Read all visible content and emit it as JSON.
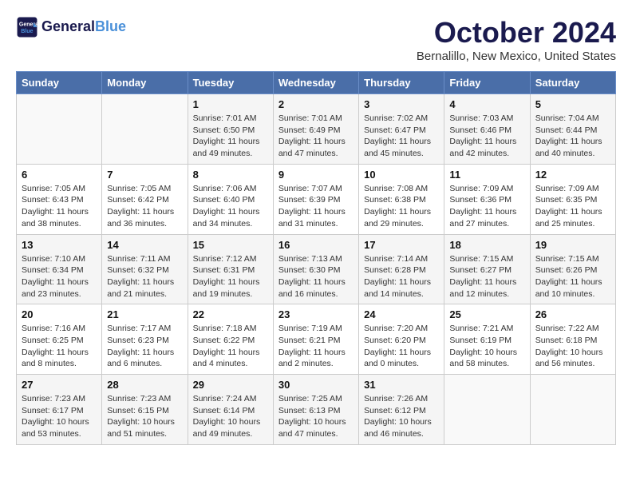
{
  "header": {
    "logo_line1": "General",
    "logo_line2": "Blue",
    "month": "October 2024",
    "location": "Bernalillo, New Mexico, United States"
  },
  "days_of_week": [
    "Sunday",
    "Monday",
    "Tuesday",
    "Wednesday",
    "Thursday",
    "Friday",
    "Saturday"
  ],
  "weeks": [
    [
      {
        "day": "",
        "sunrise": "",
        "sunset": "",
        "daylight": ""
      },
      {
        "day": "",
        "sunrise": "",
        "sunset": "",
        "daylight": ""
      },
      {
        "day": "1",
        "sunrise": "Sunrise: 7:01 AM",
        "sunset": "Sunset: 6:50 PM",
        "daylight": "Daylight: 11 hours and 49 minutes."
      },
      {
        "day": "2",
        "sunrise": "Sunrise: 7:01 AM",
        "sunset": "Sunset: 6:49 PM",
        "daylight": "Daylight: 11 hours and 47 minutes."
      },
      {
        "day": "3",
        "sunrise": "Sunrise: 7:02 AM",
        "sunset": "Sunset: 6:47 PM",
        "daylight": "Daylight: 11 hours and 45 minutes."
      },
      {
        "day": "4",
        "sunrise": "Sunrise: 7:03 AM",
        "sunset": "Sunset: 6:46 PM",
        "daylight": "Daylight: 11 hours and 42 minutes."
      },
      {
        "day": "5",
        "sunrise": "Sunrise: 7:04 AM",
        "sunset": "Sunset: 6:44 PM",
        "daylight": "Daylight: 11 hours and 40 minutes."
      }
    ],
    [
      {
        "day": "6",
        "sunrise": "Sunrise: 7:05 AM",
        "sunset": "Sunset: 6:43 PM",
        "daylight": "Daylight: 11 hours and 38 minutes."
      },
      {
        "day": "7",
        "sunrise": "Sunrise: 7:05 AM",
        "sunset": "Sunset: 6:42 PM",
        "daylight": "Daylight: 11 hours and 36 minutes."
      },
      {
        "day": "8",
        "sunrise": "Sunrise: 7:06 AM",
        "sunset": "Sunset: 6:40 PM",
        "daylight": "Daylight: 11 hours and 34 minutes."
      },
      {
        "day": "9",
        "sunrise": "Sunrise: 7:07 AM",
        "sunset": "Sunset: 6:39 PM",
        "daylight": "Daylight: 11 hours and 31 minutes."
      },
      {
        "day": "10",
        "sunrise": "Sunrise: 7:08 AM",
        "sunset": "Sunset: 6:38 PM",
        "daylight": "Daylight: 11 hours and 29 minutes."
      },
      {
        "day": "11",
        "sunrise": "Sunrise: 7:09 AM",
        "sunset": "Sunset: 6:36 PM",
        "daylight": "Daylight: 11 hours and 27 minutes."
      },
      {
        "day": "12",
        "sunrise": "Sunrise: 7:09 AM",
        "sunset": "Sunset: 6:35 PM",
        "daylight": "Daylight: 11 hours and 25 minutes."
      }
    ],
    [
      {
        "day": "13",
        "sunrise": "Sunrise: 7:10 AM",
        "sunset": "Sunset: 6:34 PM",
        "daylight": "Daylight: 11 hours and 23 minutes."
      },
      {
        "day": "14",
        "sunrise": "Sunrise: 7:11 AM",
        "sunset": "Sunset: 6:32 PM",
        "daylight": "Daylight: 11 hours and 21 minutes."
      },
      {
        "day": "15",
        "sunrise": "Sunrise: 7:12 AM",
        "sunset": "Sunset: 6:31 PM",
        "daylight": "Daylight: 11 hours and 19 minutes."
      },
      {
        "day": "16",
        "sunrise": "Sunrise: 7:13 AM",
        "sunset": "Sunset: 6:30 PM",
        "daylight": "Daylight: 11 hours and 16 minutes."
      },
      {
        "day": "17",
        "sunrise": "Sunrise: 7:14 AM",
        "sunset": "Sunset: 6:28 PM",
        "daylight": "Daylight: 11 hours and 14 minutes."
      },
      {
        "day": "18",
        "sunrise": "Sunrise: 7:15 AM",
        "sunset": "Sunset: 6:27 PM",
        "daylight": "Daylight: 11 hours and 12 minutes."
      },
      {
        "day": "19",
        "sunrise": "Sunrise: 7:15 AM",
        "sunset": "Sunset: 6:26 PM",
        "daylight": "Daylight: 11 hours and 10 minutes."
      }
    ],
    [
      {
        "day": "20",
        "sunrise": "Sunrise: 7:16 AM",
        "sunset": "Sunset: 6:25 PM",
        "daylight": "Daylight: 11 hours and 8 minutes."
      },
      {
        "day": "21",
        "sunrise": "Sunrise: 7:17 AM",
        "sunset": "Sunset: 6:23 PM",
        "daylight": "Daylight: 11 hours and 6 minutes."
      },
      {
        "day": "22",
        "sunrise": "Sunrise: 7:18 AM",
        "sunset": "Sunset: 6:22 PM",
        "daylight": "Daylight: 11 hours and 4 minutes."
      },
      {
        "day": "23",
        "sunrise": "Sunrise: 7:19 AM",
        "sunset": "Sunset: 6:21 PM",
        "daylight": "Daylight: 11 hours and 2 minutes."
      },
      {
        "day": "24",
        "sunrise": "Sunrise: 7:20 AM",
        "sunset": "Sunset: 6:20 PM",
        "daylight": "Daylight: 11 hours and 0 minutes."
      },
      {
        "day": "25",
        "sunrise": "Sunrise: 7:21 AM",
        "sunset": "Sunset: 6:19 PM",
        "daylight": "Daylight: 10 hours and 58 minutes."
      },
      {
        "day": "26",
        "sunrise": "Sunrise: 7:22 AM",
        "sunset": "Sunset: 6:18 PM",
        "daylight": "Daylight: 10 hours and 56 minutes."
      }
    ],
    [
      {
        "day": "27",
        "sunrise": "Sunrise: 7:23 AM",
        "sunset": "Sunset: 6:17 PM",
        "daylight": "Daylight: 10 hours and 53 minutes."
      },
      {
        "day": "28",
        "sunrise": "Sunrise: 7:23 AM",
        "sunset": "Sunset: 6:15 PM",
        "daylight": "Daylight: 10 hours and 51 minutes."
      },
      {
        "day": "29",
        "sunrise": "Sunrise: 7:24 AM",
        "sunset": "Sunset: 6:14 PM",
        "daylight": "Daylight: 10 hours and 49 minutes."
      },
      {
        "day": "30",
        "sunrise": "Sunrise: 7:25 AM",
        "sunset": "Sunset: 6:13 PM",
        "daylight": "Daylight: 10 hours and 47 minutes."
      },
      {
        "day": "31",
        "sunrise": "Sunrise: 7:26 AM",
        "sunset": "Sunset: 6:12 PM",
        "daylight": "Daylight: 10 hours and 46 minutes."
      },
      {
        "day": "",
        "sunrise": "",
        "sunset": "",
        "daylight": ""
      },
      {
        "day": "",
        "sunrise": "",
        "sunset": "",
        "daylight": ""
      }
    ]
  ]
}
